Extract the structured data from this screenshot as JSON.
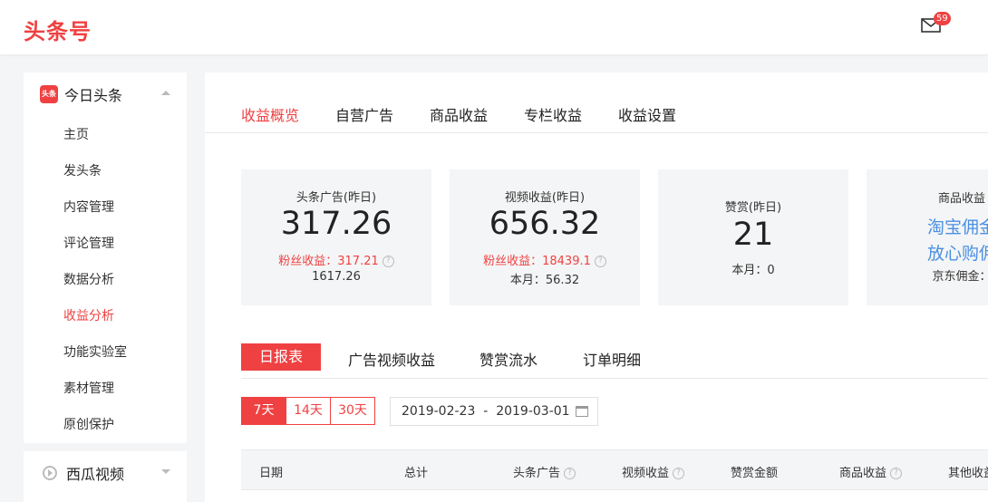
{
  "header": {
    "logo": "头条号",
    "mail_badge": "59"
  },
  "sidebar": {
    "group1": {
      "icon_text": "头条",
      "title": "今日头条",
      "items": [
        "主页",
        "发头条",
        "内容管理",
        "评论管理",
        "数据分析",
        "收益分析",
        "功能实验室",
        "素材管理",
        "原创保护"
      ],
      "active_index": 5
    },
    "group2": {
      "title": "西瓜视频"
    }
  },
  "tabs": [
    "收益概览",
    "自营广告",
    "商品收益",
    "专栏收益",
    "收益设置"
  ],
  "cards": {
    "ad": {
      "label": "头条广告(昨日)",
      "value": "317.26",
      "fans": "粉丝收益：317.21",
      "sub": "1617.26"
    },
    "video": {
      "label": "视频收益(昨日)",
      "value": "656.32",
      "fans": "粉丝收益：18439.1",
      "sub": "本月：56.32"
    },
    "reward": {
      "label": "赞赏(昨日)",
      "value": "21",
      "sub": "本月：0"
    },
    "goods": {
      "label": "商品收益",
      "link1": "淘宝佣金",
      "link2": "放心购佣",
      "sub": "京东佣金："
    }
  },
  "subtabs": [
    "日报表",
    "广告视频收益",
    "赞赏流水",
    "订单明细"
  ],
  "ranges": [
    "7天",
    "14天",
    "30天"
  ],
  "date_range": "2019-02-23  -  2019-03-01",
  "table": {
    "headers": [
      "日期",
      "总计",
      "头条广告",
      "视频收益",
      "赞赏金额",
      "商品收益",
      "其他收益"
    ]
  },
  "colors": {
    "accent": "#f04142",
    "link": "#4a90e2"
  }
}
